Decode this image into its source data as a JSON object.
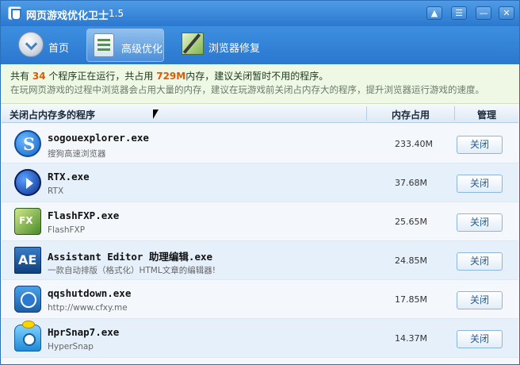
{
  "window": {
    "title": "网页游戏优化卫士",
    "version": "1.5",
    "controls": [
      "▲",
      "☰",
      "—",
      "✕"
    ]
  },
  "nav": {
    "home": "首页",
    "advanced": "高级优化",
    "browser_fix": "浏览器修复"
  },
  "info": {
    "prefix": "共有",
    "count": "34",
    "mid": "个程序正在运行，共占用",
    "memory": "729",
    "unit": "M",
    "suffix": "内存，建议关闭暂时不用的程序。",
    "detail": "在玩网页游戏的过程中浏览器会占用大量的内存，建议在玩游戏前关闭占内存大的程序，提升浏览器运行游戏的速度。"
  },
  "table": {
    "headers": {
      "name": "关闭占内存多的程序",
      "memory": "内存占用",
      "manage": "管理"
    },
    "rows": [
      {
        "name": "sogouexplorer.exe",
        "desc": "搜狗高速浏览器",
        "memory": "233.40M",
        "action": "关闭",
        "icon": "sogou-icon"
      },
      {
        "name": "RTX.exe",
        "desc": "RTX",
        "memory": "37.68M",
        "action": "关闭",
        "icon": "rtx-icon"
      },
      {
        "name": "FlashFXP.exe",
        "desc": "FlashFXP",
        "memory": "25.65M",
        "action": "关闭",
        "icon": "flashfxp-icon"
      },
      {
        "name": "Assistant Editor 助理编辑.exe",
        "desc": "一款自动排版（格式化）HTML文章的编辑器!",
        "memory": "24.85M",
        "action": "关闭",
        "icon": "assistant-editor-icon"
      },
      {
        "name": "qqshutdown.exe",
        "desc": "http://www.cfxy.me",
        "memory": "17.85M",
        "action": "关闭",
        "icon": "qqshutdown-icon"
      },
      {
        "name": "HprSnap7.exe",
        "desc": "HyperSnap",
        "memory": "14.37M",
        "action": "关闭",
        "icon": "hypersnap-icon"
      }
    ]
  },
  "colors": {
    "titlebar": "#2a78cf",
    "highlight": "#e05a00",
    "info_bg": "#eef8e4"
  }
}
